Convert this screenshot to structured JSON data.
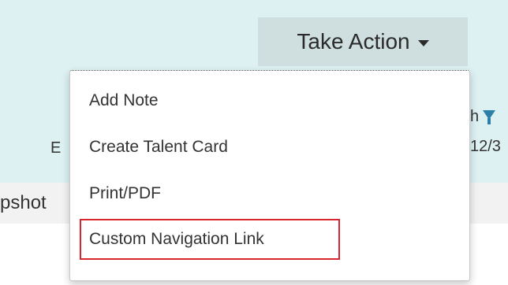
{
  "header": {
    "take_action_label": "Take Action"
  },
  "background": {
    "left_text_1": "E",
    "left_text_2": "pshot",
    "right_text_1": "h",
    "right_text_2": "12/3"
  },
  "dropdown": {
    "items": [
      {
        "label": "Add Note"
      },
      {
        "label": "Create Talent Card"
      },
      {
        "label": "Print/PDF"
      },
      {
        "label": "Custom Navigation Link"
      }
    ]
  },
  "colors": {
    "header_bg": "#ddf1f3",
    "button_bg": "#cfdfe0",
    "highlight_border": "#d9262c",
    "filter_icon": "#2c7fa8"
  },
  "icons": {
    "caret": "chevron-down-icon",
    "filter": "filter-icon"
  }
}
